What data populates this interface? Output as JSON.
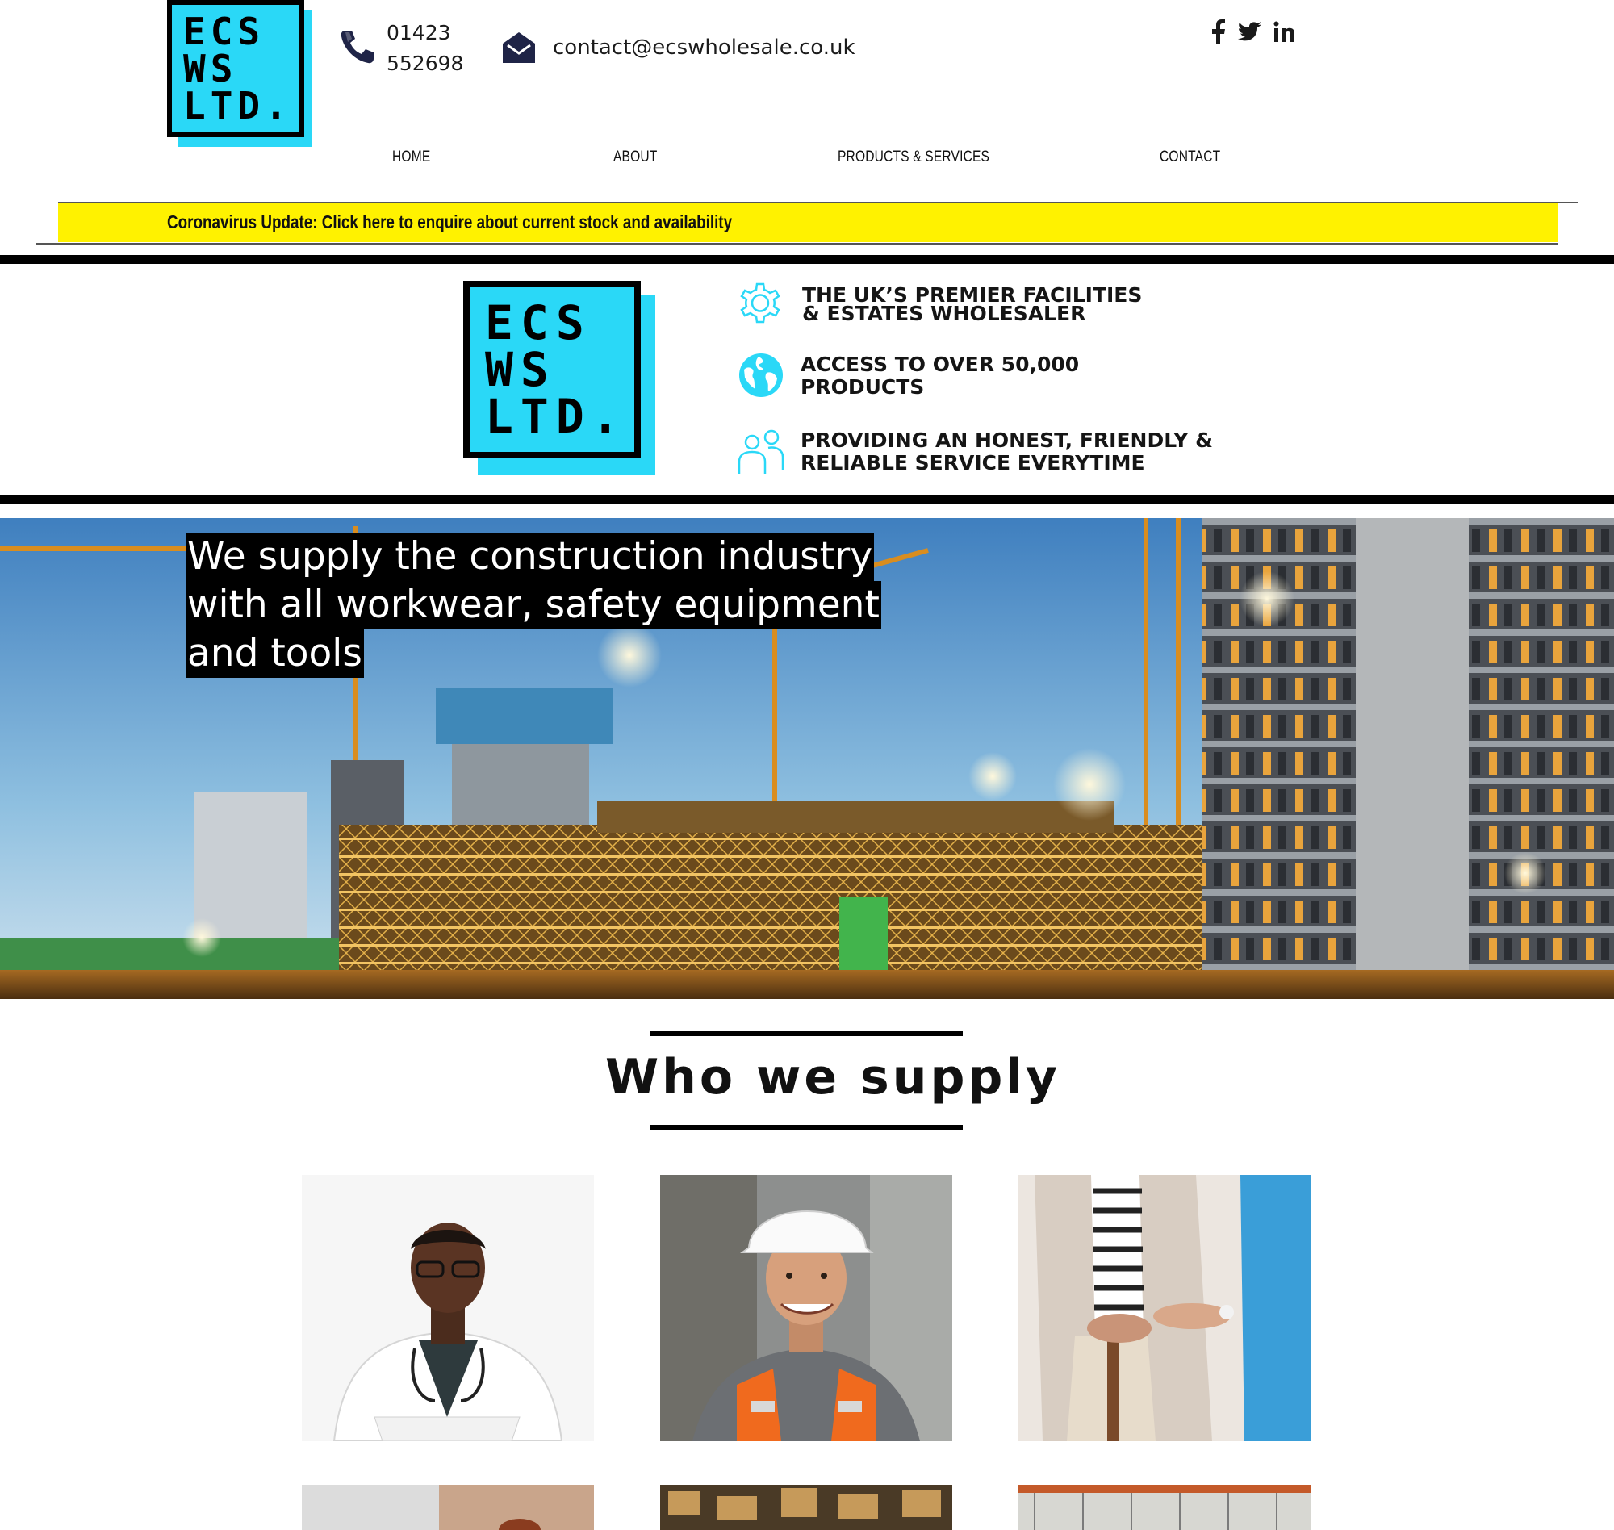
{
  "header": {
    "logo_lines": [
      "ECS",
      "WS",
      "LTD."
    ],
    "phone_lines": [
      "01423",
      "552698"
    ],
    "email": "contact@ecswholesale.co.uk",
    "social": [
      "facebook",
      "twitter",
      "linkedin"
    ],
    "social_glyphs": {
      "facebook": "f",
      "twitter": "ᵯ",
      "linkedin": "in"
    }
  },
  "nav": {
    "items": [
      "HOME",
      "ABOUT",
      "PRODUCTS & SERVICES",
      "CONTACT"
    ]
  },
  "banner": {
    "text": "Coronavirus Update: Click here to enquire about current stock and availability"
  },
  "features": {
    "logo_lines": [
      "ECS",
      "WS",
      "LTD."
    ],
    "items": [
      {
        "icon": "gear-icon",
        "lines": [
          "THE UK’S PREMIER FACILITIES",
          "& ESTATES WHOLESALER"
        ]
      },
      {
        "icon": "globe-icon",
        "lines": [
          "ACCESS TO OVER 50,000",
          "PRODUCTS"
        ]
      },
      {
        "icon": "people-icon",
        "lines": [
          "PROVIDING AN HONEST, FRIENDLY &",
          "RELIABLE SERVICE EVERYTIME"
        ]
      }
    ]
  },
  "hero": {
    "lines": [
      "We supply the construction industry",
      "with all workwear, safety equipment",
      "and tools"
    ]
  },
  "section": {
    "heading": "Who we supply"
  },
  "colors": {
    "accent": "#2ad8f7",
    "banner": "#fff200",
    "icon_navy": "#1f2447"
  }
}
